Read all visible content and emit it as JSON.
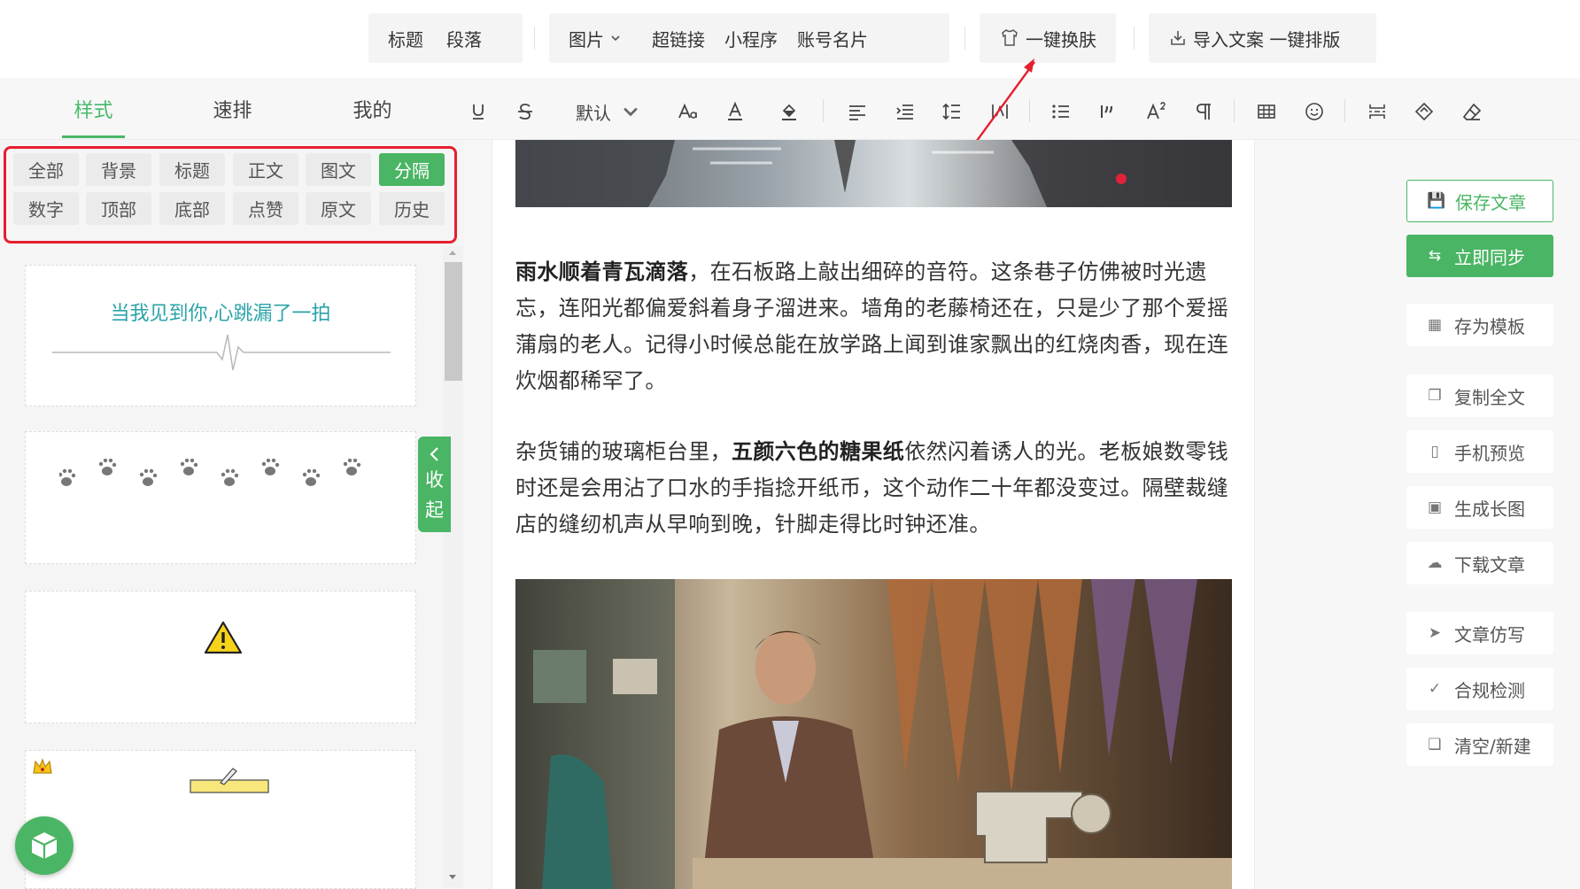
{
  "top_insert_bar": {
    "heading": "标题",
    "paragraph": "段落",
    "image": "图片",
    "hyperlink": "超链接",
    "miniprogram": "小程序",
    "account_card": "账号名片",
    "one_click_skin": "一键换肤",
    "import_layout": "导入文案 一键排版"
  },
  "panel_tabs": [
    "样式",
    "速排",
    "我的"
  ],
  "format_toolbar": {
    "font_size_default": "默认"
  },
  "filter_chips": [
    "全部",
    "背景",
    "标题",
    "正文",
    "图文",
    "分隔",
    "数字",
    "顶部",
    "底部",
    "点赞",
    "原文",
    "历史"
  ],
  "active_chip": "分隔",
  "style_cards": {
    "heartbeat_text": "当我见到你,心跳漏了一拍"
  },
  "collapse_tab": [
    "收",
    "起"
  ],
  "editor": {
    "p1_bold": "雨水顺着青瓦滴落",
    "p1_rest": "，在石板路上敲出细碎的音符。这条巷子仿佛被时光遗忘，连阳光都偏爱斜着身子溜进来。墙角的老藤椅还在，只是少了那个爱摇蒲扇的老人。记得小时候总能在放学路上闻到谁家飘出的红烧肉香，现在连炊烟都稀罕了。",
    "p2_start": "杂货铺的玻璃柜台里，",
    "p2_bold": "五颜六色的糖果纸",
    "p2_rest": "依然闪着诱人的光。老板娘数零钱时还是会用沾了口水的手指捻开纸币，这个动作二十年都没变过。隔壁裁缝店的缝纫机声从早响到晚，针脚走得比时钟还准。"
  },
  "right_sidebar": {
    "save": "保存文章",
    "sync": "立即同步",
    "save_template": "存为模板",
    "copy_all": "复制全文",
    "mobile_preview": "手机预览",
    "long_image": "生成长图",
    "download": "下载文章",
    "imitate": "文章仿写",
    "compliance": "合规检测",
    "clear_new": "清空/新建"
  },
  "colors": {
    "accent": "#4ab564",
    "highlight_border": "#e5202e",
    "heartbeat_text": "#2aa3a8"
  }
}
